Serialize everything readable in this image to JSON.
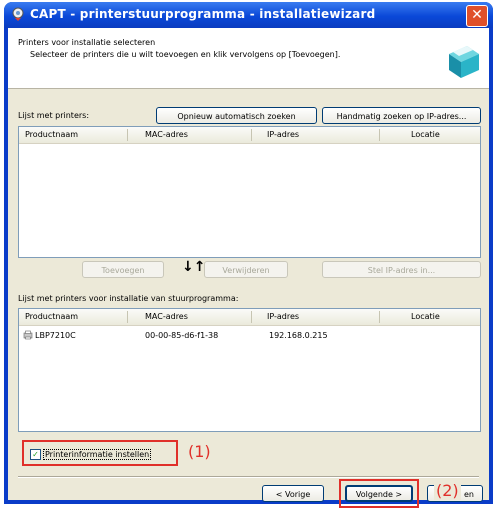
{
  "window": {
    "title": "CAPT - printerstuurprogramma - installatiewizard",
    "close_label": "✕"
  },
  "header": {
    "title": "Printers voor installatie selecteren",
    "description": "Selecteer de printers die u wilt toevoegen en klik vervolgens op [Toevoegen]."
  },
  "printers_list": {
    "label": "Lijst met printers:",
    "research_button": "Opnieuw automatisch zoeken",
    "manual_search_button": "Handmatig zoeken op IP-adres...",
    "columns": [
      "Productnaam",
      "MAC-adres",
      "IP-adres",
      "Locatie"
    ]
  },
  "middle": {
    "add_button": "Toevoegen",
    "arrows": "↓↑",
    "remove_button": "Verwijderen",
    "set_ip_button": "Stel IP-adres in..."
  },
  "install_list": {
    "label": "Lijst met printers voor installatie van stuurprogramma:",
    "columns": [
      "Productnaam",
      "MAC-adres",
      "IP-adres",
      "Locatie"
    ],
    "rows": [
      {
        "product": "LBP7210C",
        "mac": "00-00-85-d6-f1-38",
        "ip": "192.168.0.215",
        "location": ""
      }
    ]
  },
  "options": {
    "printer_info_checkbox": "Printerinformatie instellen",
    "checked_mark": "✓"
  },
  "footer": {
    "back_button": "< Vorige",
    "next_button": "Volgende >",
    "cancel_button": "en"
  },
  "annotations": {
    "label1": "(1)",
    "label2": "(2)",
    "color": "#e0302a"
  }
}
